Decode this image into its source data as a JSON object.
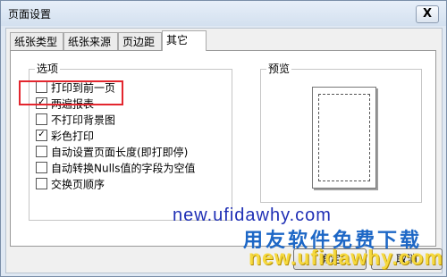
{
  "window": {
    "title": "页面设置",
    "close_label": "X"
  },
  "tabs": [
    {
      "label": "纸张类型",
      "active": false
    },
    {
      "label": "纸张来源",
      "active": false
    },
    {
      "label": "页边距",
      "active": false
    },
    {
      "label": "其它",
      "active": true
    }
  ],
  "options_group": {
    "title": "选项",
    "items": [
      {
        "label": "打印到前一页",
        "checked": false
      },
      {
        "label": "两遍报表",
        "checked": true
      },
      {
        "label": "不打印背景图",
        "checked": false
      },
      {
        "label": "彩色打印",
        "checked": true
      },
      {
        "label": "自动设置页面长度(即打即停)",
        "checked": false
      },
      {
        "label": "自动转换Nulls值的字段为空值",
        "checked": false
      },
      {
        "label": "交换页顺序",
        "checked": false
      }
    ]
  },
  "preview_group": {
    "title": "预览"
  },
  "buttons": {
    "ok_label": "确定",
    "cancel_label": "取消"
  },
  "watermark": {
    "url": "new.ufidawhy.com",
    "slogan": "用友软件免费下载",
    "url_overlay": "new.ufidawhy.com"
  },
  "colors": {
    "highlight": "#e3262e",
    "watermark_blue": "#1d67c6",
    "watermark_yellow": "#f6d93e"
  }
}
